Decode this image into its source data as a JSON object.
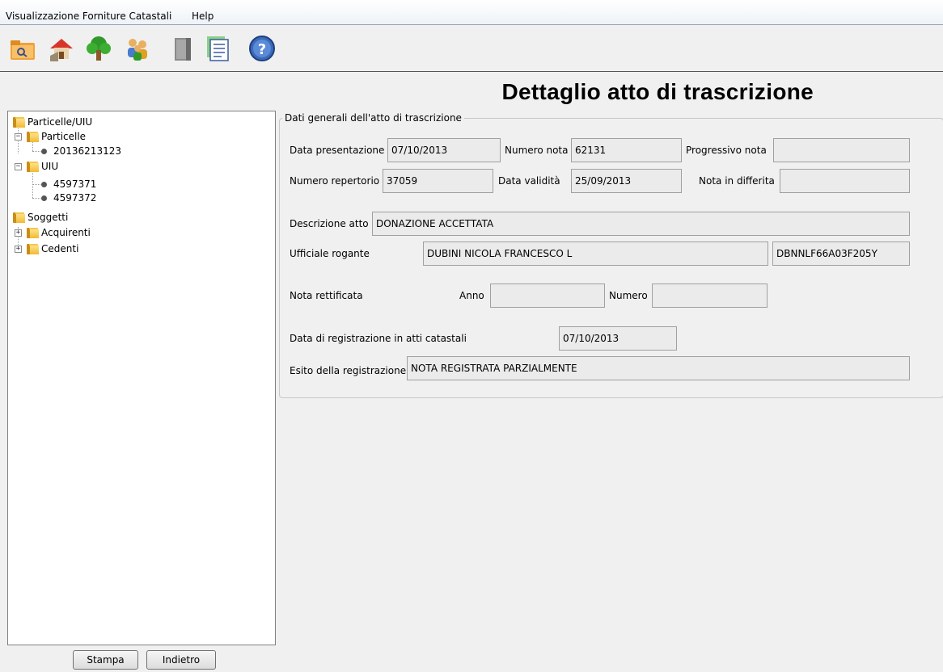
{
  "menu": {
    "item1": "Visualizzazione Forniture Catastali",
    "item2": "Help"
  },
  "toolbar": {
    "buttons": [
      "folder-search-icon",
      "house-icon",
      "tree-icon",
      "people-icon",
      "door-icon",
      "document-list-icon",
      "help-icon"
    ]
  },
  "page": {
    "title": "Dettaglio atto di trascrizione"
  },
  "tree": {
    "root1": "Particelle/UIU",
    "particelle": "Particelle",
    "particella1": "20136213123",
    "uiu": "UIU",
    "uiu1": "4597371",
    "uiu2": "4597372",
    "root2": "Soggetti",
    "acquirenti": "Acquirenti",
    "cedenti": "Cedenti"
  },
  "buttons": {
    "print": "Stampa",
    "back": "Indietro"
  },
  "form": {
    "group_title": "Dati generali dell'atto di trascrizione",
    "data_presentazione_label": "Data presentazione",
    "data_presentazione": "07/10/2013",
    "numero_nota_label": "Numero nota",
    "numero_nota": "62131",
    "progressivo_nota_label": "Progressivo nota",
    "progressivo_nota": "",
    "numero_repertorio_label": "Numero repertorio",
    "numero_repertorio": "37059",
    "data_validita_label": "Data validità",
    "data_validita": "25/09/2013",
    "nota_differita_label": "Nota in differita",
    "nota_differita": "",
    "descrizione_label": "Descrizione atto",
    "descrizione": "DONAZIONE ACCETTATA",
    "ufficiale_label": "Ufficiale rogante",
    "ufficiale_nome": "DUBINI NICOLA FRANCESCO L",
    "ufficiale_cf": "DBNNLF66A03F205Y",
    "nota_rettificata_label": "Nota rettificata",
    "anno_label": "Anno",
    "anno": "",
    "numero_label": "Numero",
    "numero": "",
    "data_registrazione_label": "Data di registrazione in atti catastali",
    "data_registrazione": "07/10/2013",
    "esito_label": "Esito della registrazione",
    "esito": "NOTA REGISTRATA PARZIALMENTE"
  },
  "colors": {
    "background": "#f0f0f0",
    "field_bg": "#ebebeb",
    "folder": "#f4c84c"
  }
}
